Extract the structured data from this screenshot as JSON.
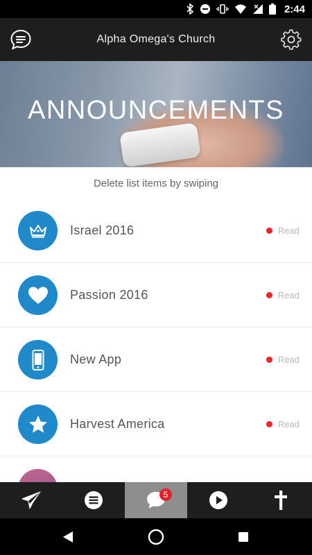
{
  "status_bar": {
    "time": "2:44"
  },
  "header": {
    "title": "Alpha Omega's Church"
  },
  "hero": {
    "title": "ANNOUNCEMENTS"
  },
  "hint": "Delete list items by swiping",
  "announcements": [
    {
      "title": "Israel 2016",
      "status": "Read",
      "icon": "crown-icon"
    },
    {
      "title": "Passion 2016",
      "status": "Read",
      "icon": "heart-icon"
    },
    {
      "title": "New App",
      "status": "Read",
      "icon": "smartphone-icon"
    },
    {
      "title": "Harvest America",
      "status": "Read",
      "icon": "star-icon"
    }
  ],
  "tabs": [
    {
      "name": "send",
      "icon": "paper-plane-icon"
    },
    {
      "name": "menu",
      "icon": "list-icon"
    },
    {
      "name": "messages",
      "icon": "chat-bubble-icon",
      "badge": "5",
      "active": true
    },
    {
      "name": "media",
      "icon": "play-icon"
    },
    {
      "name": "faith",
      "icon": "cross-icon"
    }
  ],
  "colors": {
    "accent": "#2089c9",
    "header": "#1e1e1e",
    "unread_dot": "#e8262c",
    "badge": "#e2232a"
  }
}
